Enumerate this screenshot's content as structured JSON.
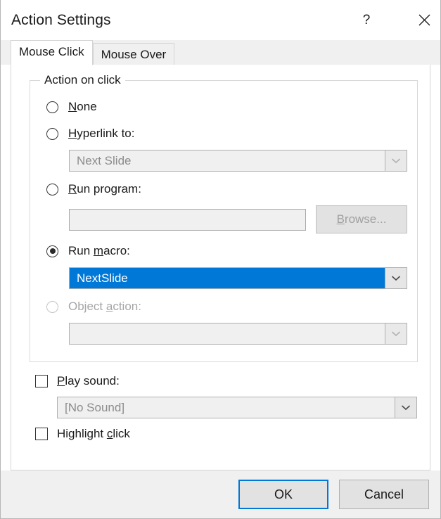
{
  "window": {
    "title": "Action Settings",
    "help_icon": "question-mark-icon",
    "close_icon": "close-icon"
  },
  "tabs": [
    {
      "label": "Mouse Click",
      "active": true
    },
    {
      "label": "Mouse Over",
      "active": false
    }
  ],
  "group": {
    "legend": "Action on click",
    "options": [
      {
        "label_pre": "",
        "accel": "N",
        "label_post": "one",
        "checked": false,
        "disabled": false
      },
      {
        "label_pre": "",
        "accel": "H",
        "label_post": "yperlink to:",
        "checked": false,
        "disabled": false
      },
      {
        "label_pre": "",
        "accel": "R",
        "label_post": "un program:",
        "checked": false,
        "disabled": false
      },
      {
        "label_pre": "Run ",
        "accel": "m",
        "label_post": "acro:",
        "checked": true,
        "disabled": false
      },
      {
        "label_pre": "Object ",
        "accel": "a",
        "label_post": "ction:",
        "checked": false,
        "disabled": true
      }
    ],
    "hyperlink_combo": {
      "value": "Next Slide",
      "disabled": true
    },
    "program_textbox": {
      "value": "",
      "placeholder": "",
      "disabled": true
    },
    "browse_button": {
      "label_pre": "",
      "accel": "B",
      "label_post": "rowse...",
      "disabled": true
    },
    "macro_combo": {
      "value": "NextSlide",
      "selected": true,
      "disabled": false
    },
    "object_action_combo": {
      "value": "",
      "disabled": true
    }
  },
  "options": {
    "play_sound": {
      "label_pre": "",
      "accel": "P",
      "label_post": "lay sound:",
      "checked": false
    },
    "sound_combo": {
      "value": "[No Sound]",
      "disabled": true
    },
    "highlight_click": {
      "label_pre": "Highlight ",
      "accel": "c",
      "label_post": "lick",
      "checked": false
    }
  },
  "footer": {
    "ok_label": "OK",
    "cancel_label": "Cancel"
  },
  "colors": {
    "accent": "#0078D7",
    "selection": "#0078D7",
    "dialog_bg": "#FFFFFF",
    "chrome_bg": "#F0F0F0",
    "disabled_text": "#A6A6A6"
  }
}
